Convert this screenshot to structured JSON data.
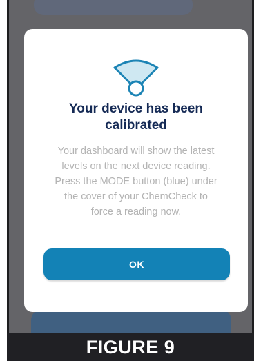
{
  "modal": {
    "icon": "wifi-sensor-icon",
    "title_line1": "Your device has been",
    "title_line2": "calibrated",
    "body_lines": [
      "Your dashboard will show the latest",
      "levels on the next device reading.",
      "Press the MODE button (blue) under",
      "the cover of your ChemCheck to",
      "force a reading now."
    ],
    "ok_label": "OK"
  },
  "caption": "FIGURE 9",
  "colors": {
    "accent": "#1382b6",
    "title": "#152a55",
    "body_text": "#b3b3b3",
    "overlay": "#646468"
  }
}
